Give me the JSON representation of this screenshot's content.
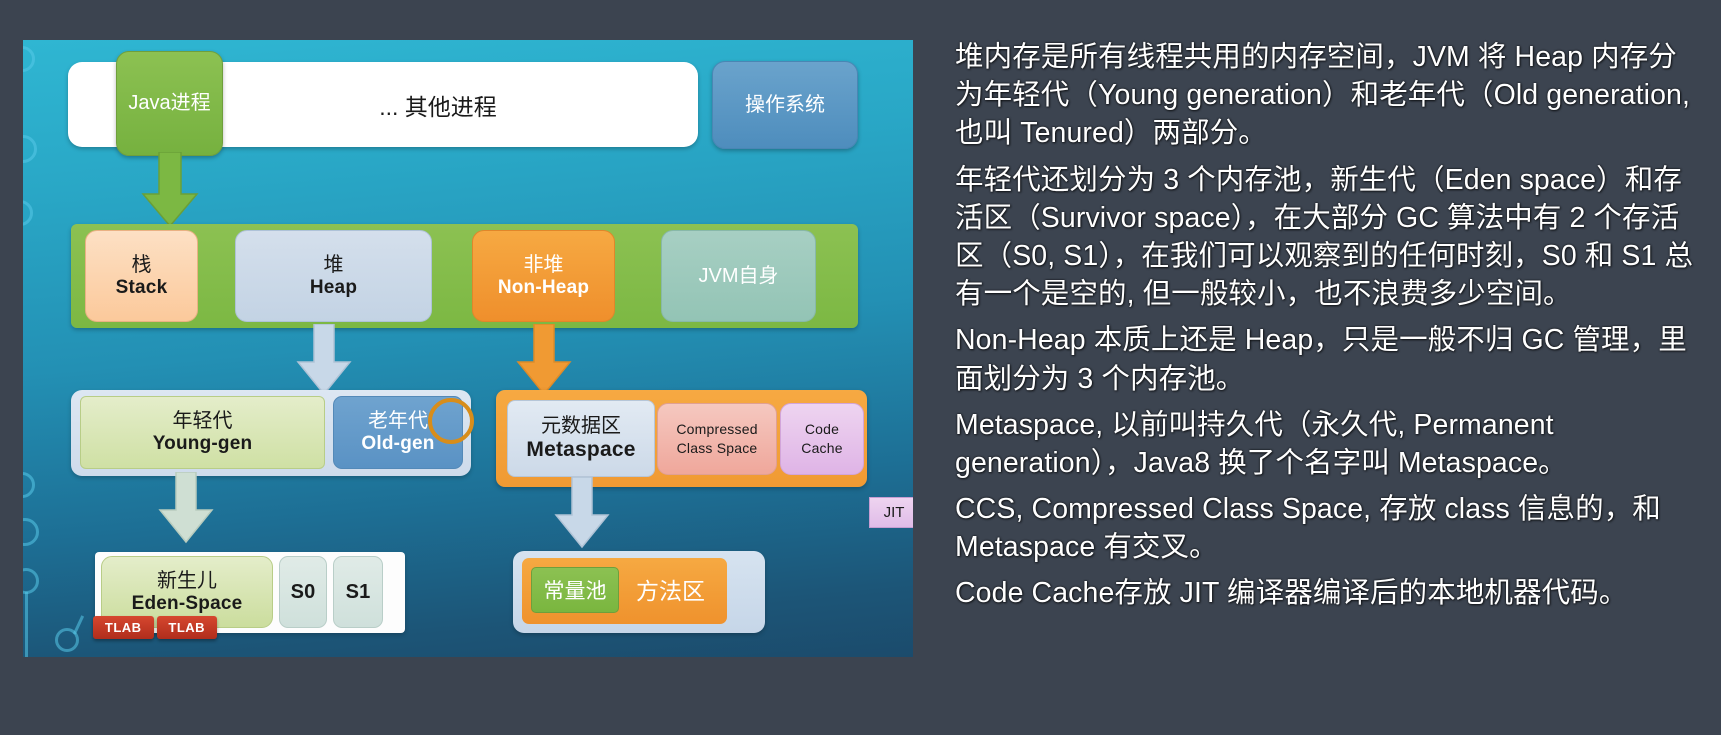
{
  "diagram": {
    "top_row": {
      "java_process": "Java进程",
      "other_processes": "... 其他进程",
      "operating_system": "操作系统"
    },
    "memory_row": {
      "stack_cn": "栈",
      "stack_en": "Stack",
      "heap_cn": "堆",
      "heap_en": "Heap",
      "nonheap_cn": "非堆",
      "nonheap_en": "Non-Heap",
      "jvm_self": "JVM自身"
    },
    "generation_row": {
      "young_cn": "年轻代",
      "young_en": "Young-gen",
      "old_cn": "老年代",
      "old_en": "Old-gen"
    },
    "nonheap_row": {
      "metaspace_cn": "元数据区",
      "metaspace_en": "Metaspace",
      "ccs_line1": "Compressed",
      "ccs_line2": "Class Space",
      "codecache_line1": "Code",
      "codecache_line2": "Cache",
      "jit": "JIT"
    },
    "bottom_row": {
      "eden_cn": "新生儿",
      "eden_en": "Eden-Space",
      "s0": "S0",
      "s1": "S1",
      "tlab_1": "TLAB",
      "tlab_2": "TLAB",
      "constant_pool": "常量池",
      "method_area": "方法区"
    },
    "colors": {
      "green": "#8cc152",
      "orange": "#f6a942",
      "blue": "#5a92c4",
      "red_tlab": "#b02d1c",
      "highlight_circle": "#d88d1a",
      "slide_bg_top": "#2fb6d2",
      "slide_bg_bottom": "#1b4b6c",
      "page_bg": "#3c4450"
    }
  },
  "notes": {
    "paragraphs": [
      "堆内存是所有线程共用的内存空间，JVM 将 Heap 内存分为年轻代（Young generation）和老年代（Old generation, 也叫 Tenured）两部分。",
      "年轻代还划分为 3 个内存池，新生代（Eden space）和存活区（Survivor space），在大部分 GC 算法中有 2 个存活区（S0, S1），在我们可以观察到的任何时刻，S0 和 S1 总有一个是空的, 但一般较小，也不浪费多少空间。",
      "Non-Heap 本质上还是 Heap，只是一般不归 GC 管理，里面划分为 3 个内存池。",
      "Metaspace, 以前叫持久代（永久代, Permanent generation），Java8 换了个名字叫 Metaspace。",
      "CCS, Compressed Class Space, 存放 class 信息的，和 Metaspace 有交叉。",
      "Code Cache存放 JIT 编译器编译后的本地机器代码。"
    ]
  }
}
